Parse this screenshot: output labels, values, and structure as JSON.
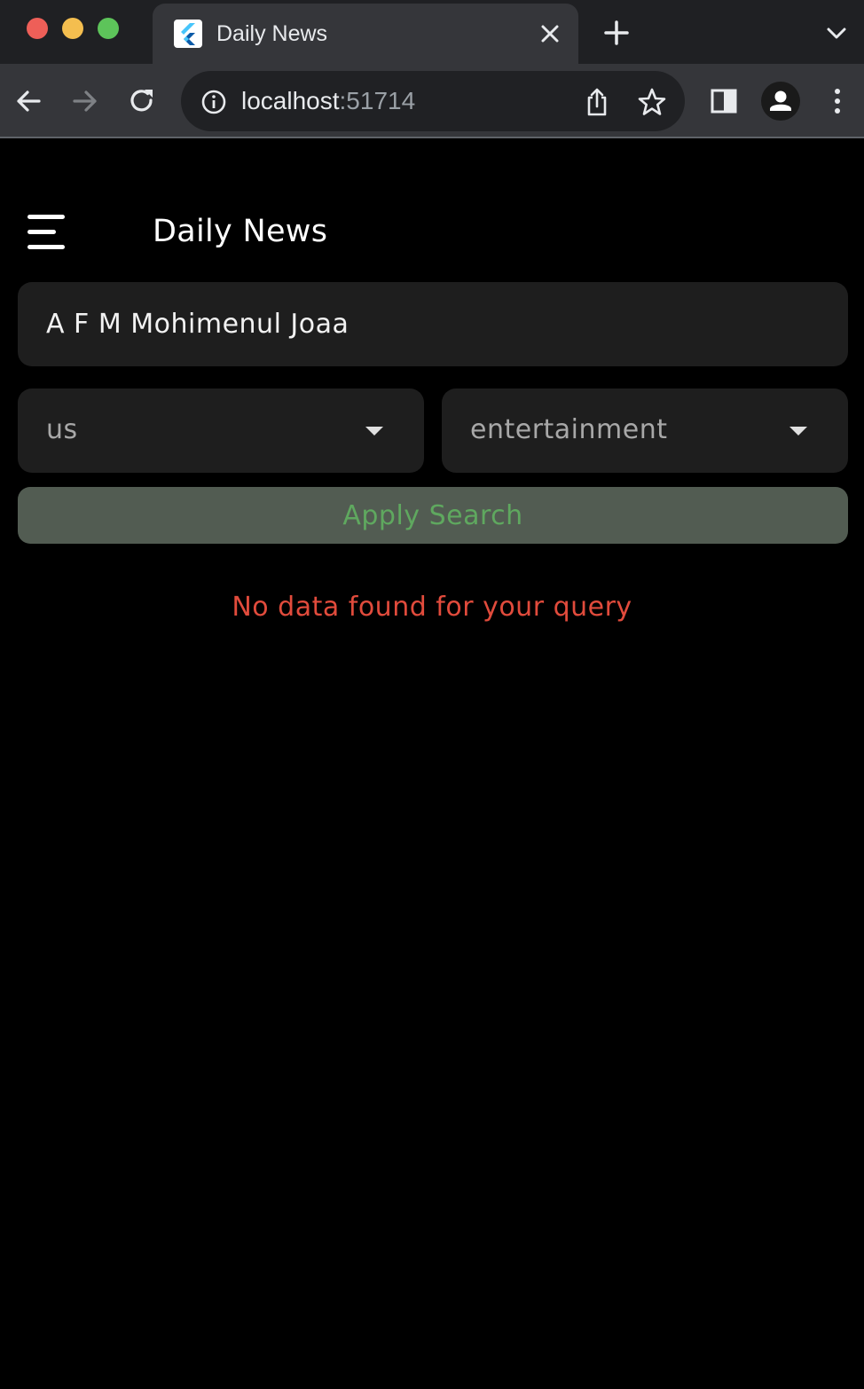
{
  "browser": {
    "tab": {
      "title": "Daily News",
      "favicon": "flutter-logo"
    },
    "address_bar": {
      "host": "localhost",
      "port": ":51714"
    },
    "icons": {
      "back": "arrow-left-icon",
      "forward": "arrow-right-icon",
      "reload": "reload-icon",
      "info": "info-icon",
      "share": "share-icon",
      "bookmark": "star-icon",
      "side_panel": "side-panel-icon",
      "profile": "profile-icon",
      "menu": "more-vert-icon"
    }
  },
  "app": {
    "title": "Daily News",
    "menu_icon": "hamburger-menu-icon",
    "search": {
      "value": "A F M Mohimenul Joaa"
    },
    "country_dropdown": {
      "selected": "us"
    },
    "category_dropdown": {
      "selected": "entertainment"
    },
    "apply_button": {
      "label": "Apply Search"
    },
    "empty_message": "No data found for your query"
  },
  "colors": {
    "background": "#000000",
    "field_background": "#1e1e1e",
    "button_background": "#525c52",
    "button_text": "#5fa85f",
    "error_text": "#e14b3c"
  }
}
